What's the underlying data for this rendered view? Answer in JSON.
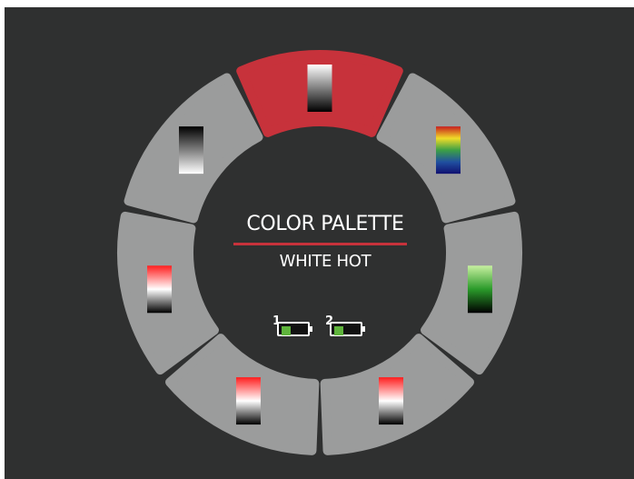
{
  "title": "COLOR PALETTE",
  "selected_palette": "WHITE HOT",
  "palettes": [
    {
      "id": "white-hot",
      "selected": true,
      "stops": [
        "#ffffff",
        "#000000"
      ]
    },
    {
      "id": "rainbow",
      "selected": false,
      "stops": [
        "#c81e1e",
        "#f0dc28",
        "#3ca046",
        "#2050a0",
        "#101070"
      ]
    },
    {
      "id": "green-hot",
      "selected": false,
      "stops": [
        "#c8f0a0",
        "#2a9a2a",
        "#000000"
      ]
    },
    {
      "id": "red-hot-white",
      "selected": false,
      "stops": [
        "#ff1e1e",
        "#ffffff",
        "#000000"
      ]
    },
    {
      "id": "red-hot-white-2",
      "selected": false,
      "stops": [
        "#ff1e1e",
        "#ffffff",
        "#000000"
      ]
    },
    {
      "id": "red-hot-white-3",
      "selected": false,
      "stops": [
        "#ff1e1e",
        "#ffffff",
        "#000000"
      ]
    },
    {
      "id": "black-hot",
      "selected": false,
      "stops": [
        "#000000",
        "#ffffff"
      ]
    }
  ],
  "batteries": [
    {
      "label": "1",
      "level": 0.4
    },
    {
      "label": "2",
      "level": 0.4
    }
  ],
  "colors": {
    "background": "#2f3030",
    "segment": "#9b9c9c",
    "selected": "#c7323b",
    "accent_line": "#c7323b",
    "battery_fill": "#5fb43c"
  }
}
